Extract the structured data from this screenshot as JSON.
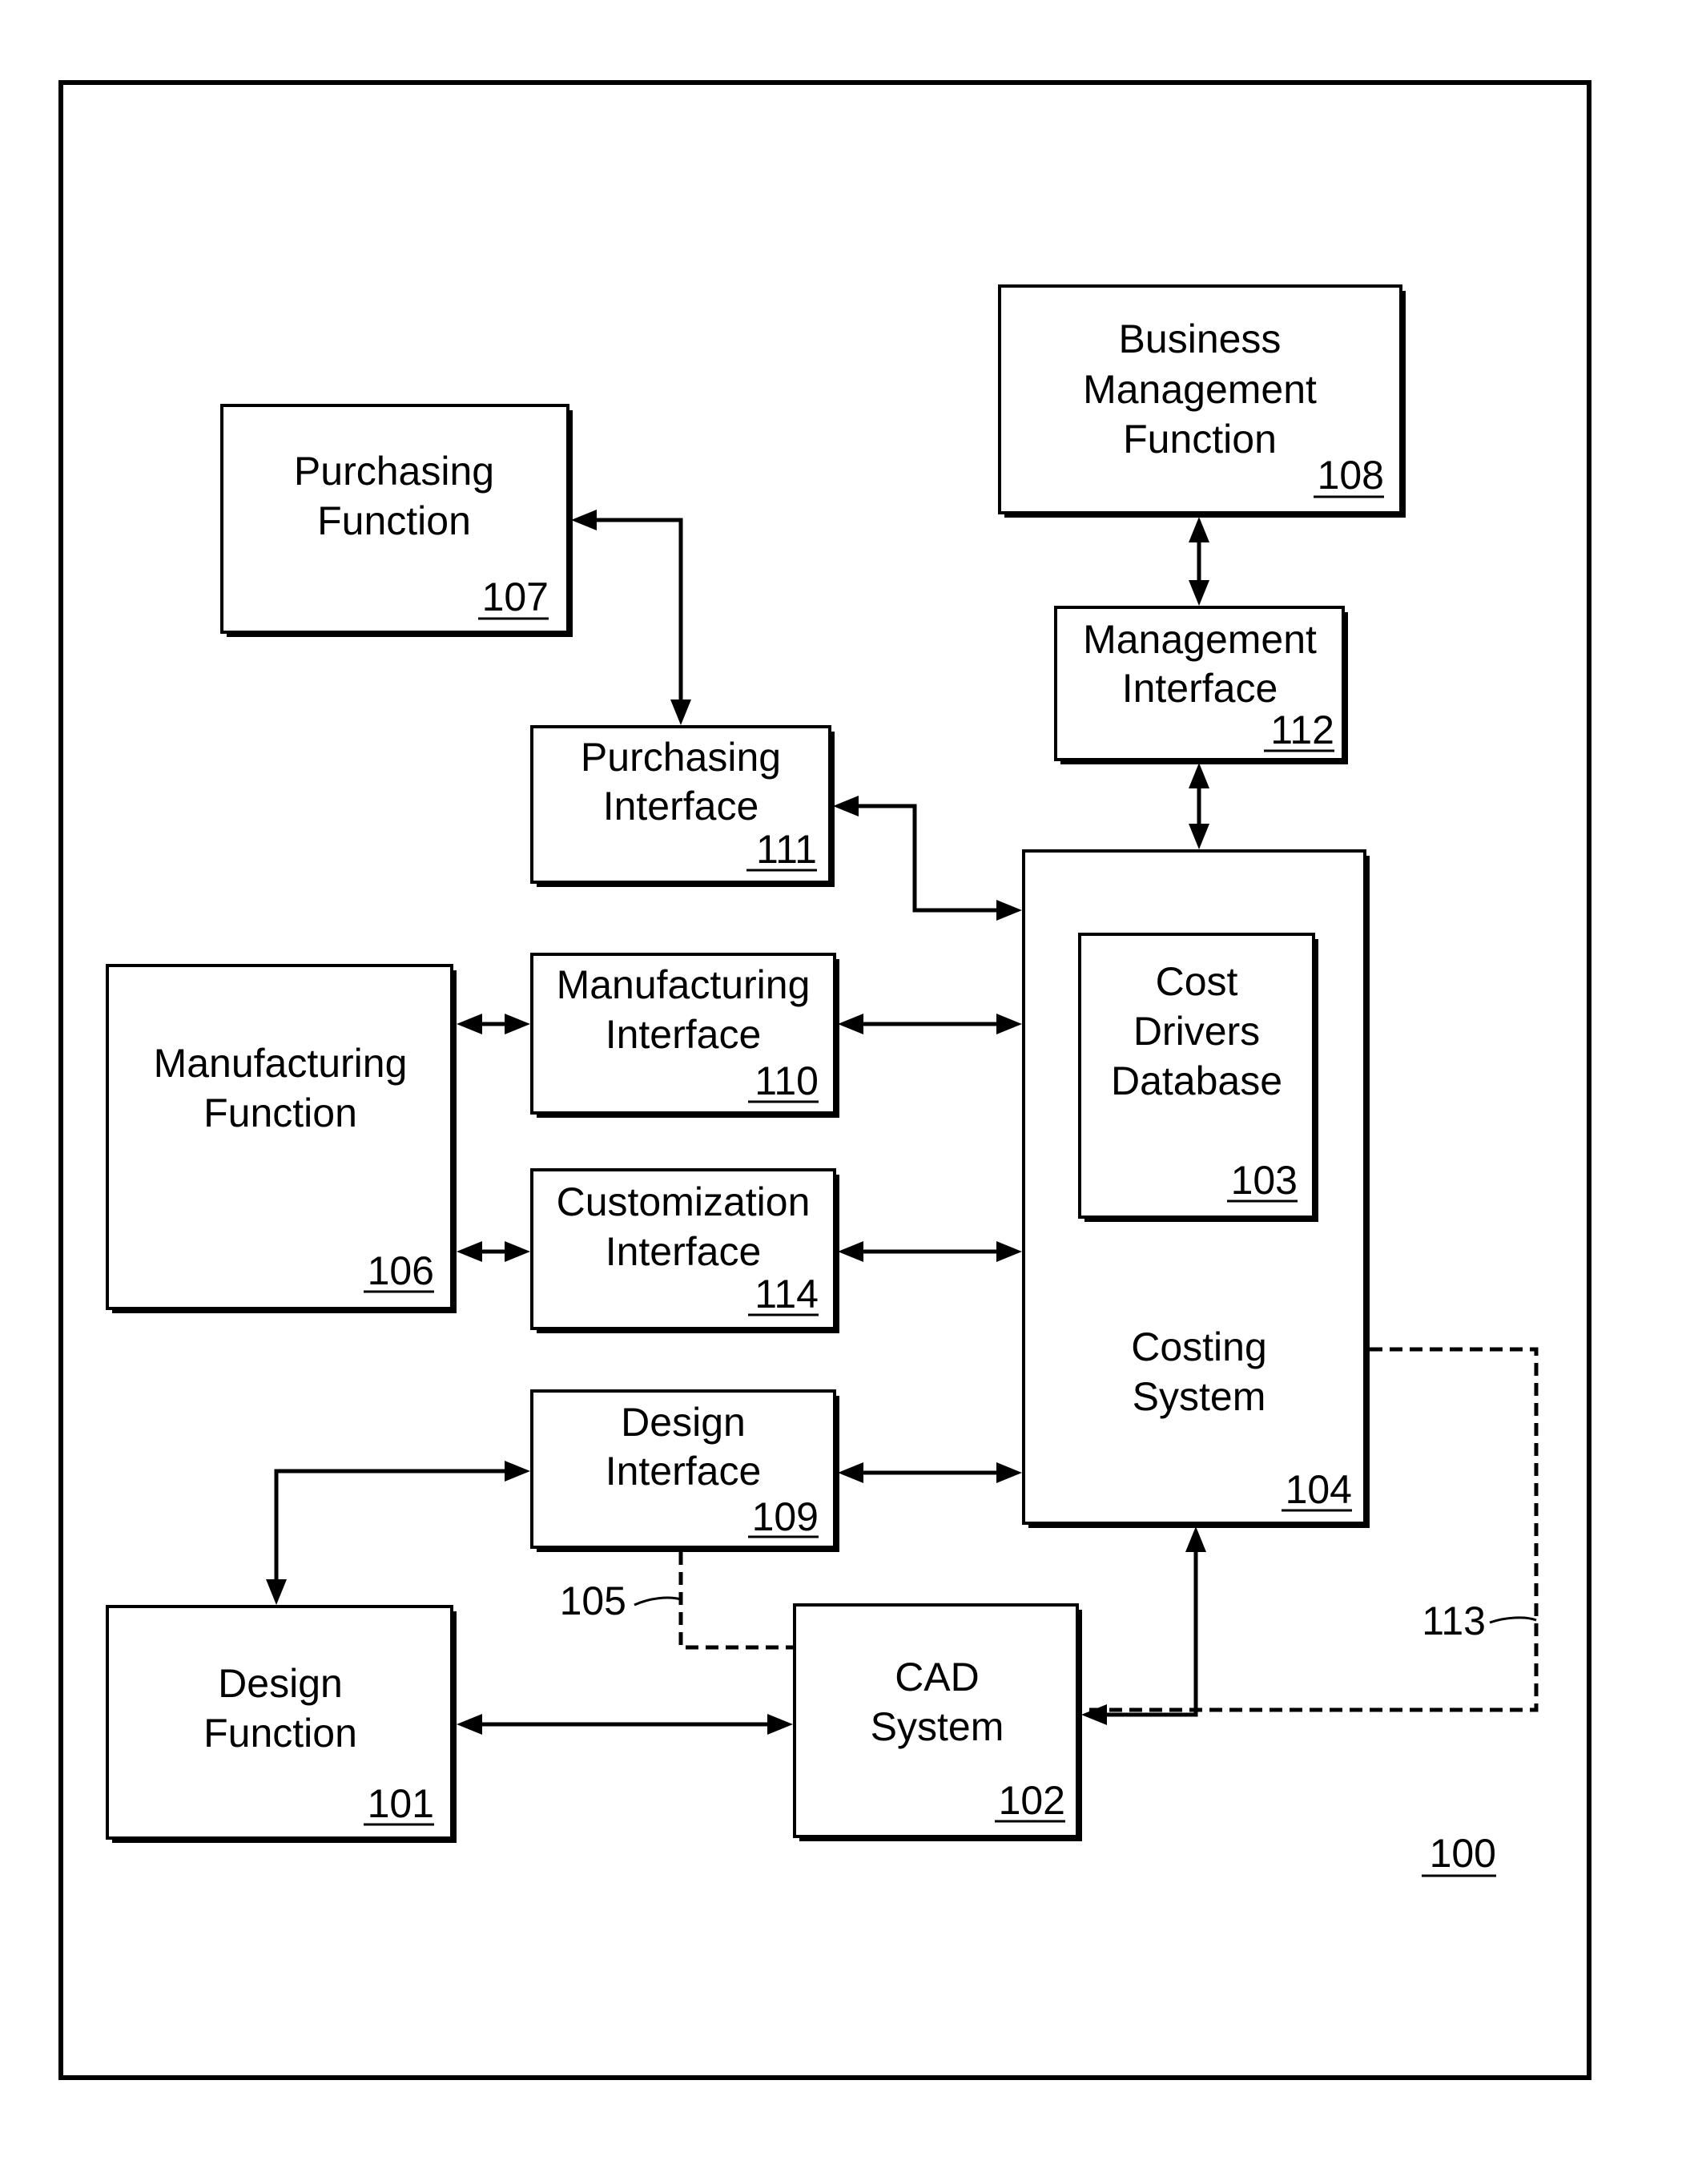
{
  "figure": {
    "reference": "100",
    "blocks": {
      "design_function": {
        "lines": [
          "Design",
          "Function"
        ],
        "ref": "101"
      },
      "cad_system": {
        "lines": [
          "CAD",
          "System"
        ],
        "ref": "102"
      },
      "cost_drivers_database": {
        "lines": [
          "Cost",
          "Drivers",
          "Database"
        ],
        "ref": "103"
      },
      "costing_system": {
        "lines": [
          "Costing",
          "System"
        ],
        "ref": "104"
      },
      "manufacturing_function": {
        "lines": [
          "Manufacturing",
          "Function"
        ],
        "ref": "106"
      },
      "purchasing_function": {
        "lines": [
          "Purchasing",
          "Function"
        ],
        "ref": "107"
      },
      "business_management_function": {
        "lines": [
          "Business",
          "Management",
          "Function"
        ],
        "ref": "108"
      },
      "design_interface": {
        "lines": [
          "Design",
          "Interface"
        ],
        "ref": "109"
      },
      "manufacturing_interface": {
        "lines": [
          "Manufacturing",
          "Interface"
        ],
        "ref": "110"
      },
      "purchasing_interface": {
        "lines": [
          "Purchasing",
          "Interface"
        ],
        "ref": "111"
      },
      "management_interface": {
        "lines": [
          "Management",
          "Interface"
        ],
        "ref": "112"
      },
      "customization_interface": {
        "lines": [
          "Customization",
          "Interface"
        ],
        "ref": "114"
      }
    },
    "dashed_links": {
      "design_interface_to_cad": "105",
      "cad_to_costing_system": "113"
    },
    "connections": [
      {
        "from": "purchasing_function",
        "to": "purchasing_interface",
        "style": "bidirectional"
      },
      {
        "from": "purchasing_interface",
        "to": "costing_system",
        "style": "bidirectional"
      },
      {
        "from": "business_management_function",
        "to": "management_interface",
        "style": "bidirectional"
      },
      {
        "from": "management_interface",
        "to": "costing_system",
        "style": "bidirectional"
      },
      {
        "from": "manufacturing_function",
        "to": "manufacturing_interface",
        "style": "bidirectional"
      },
      {
        "from": "manufacturing_interface",
        "to": "costing_system",
        "style": "bidirectional"
      },
      {
        "from": "manufacturing_function",
        "to": "customization_interface",
        "style": "bidirectional"
      },
      {
        "from": "customization_interface",
        "to": "costing_system",
        "style": "bidirectional"
      },
      {
        "from": "design_function",
        "to": "design_interface",
        "style": "bidirectional"
      },
      {
        "from": "design_interface",
        "to": "costing_system",
        "style": "bidirectional"
      },
      {
        "from": "design_function",
        "to": "cad_system",
        "style": "bidirectional"
      },
      {
        "from": "cad_system",
        "to": "costing_system",
        "style": "bidirectional"
      },
      {
        "from": "design_interface",
        "to": "cad_system",
        "style": "dashed",
        "ref": "105"
      },
      {
        "from": "cad_system",
        "to": "costing_system",
        "style": "dashed",
        "ref": "113"
      }
    ]
  }
}
